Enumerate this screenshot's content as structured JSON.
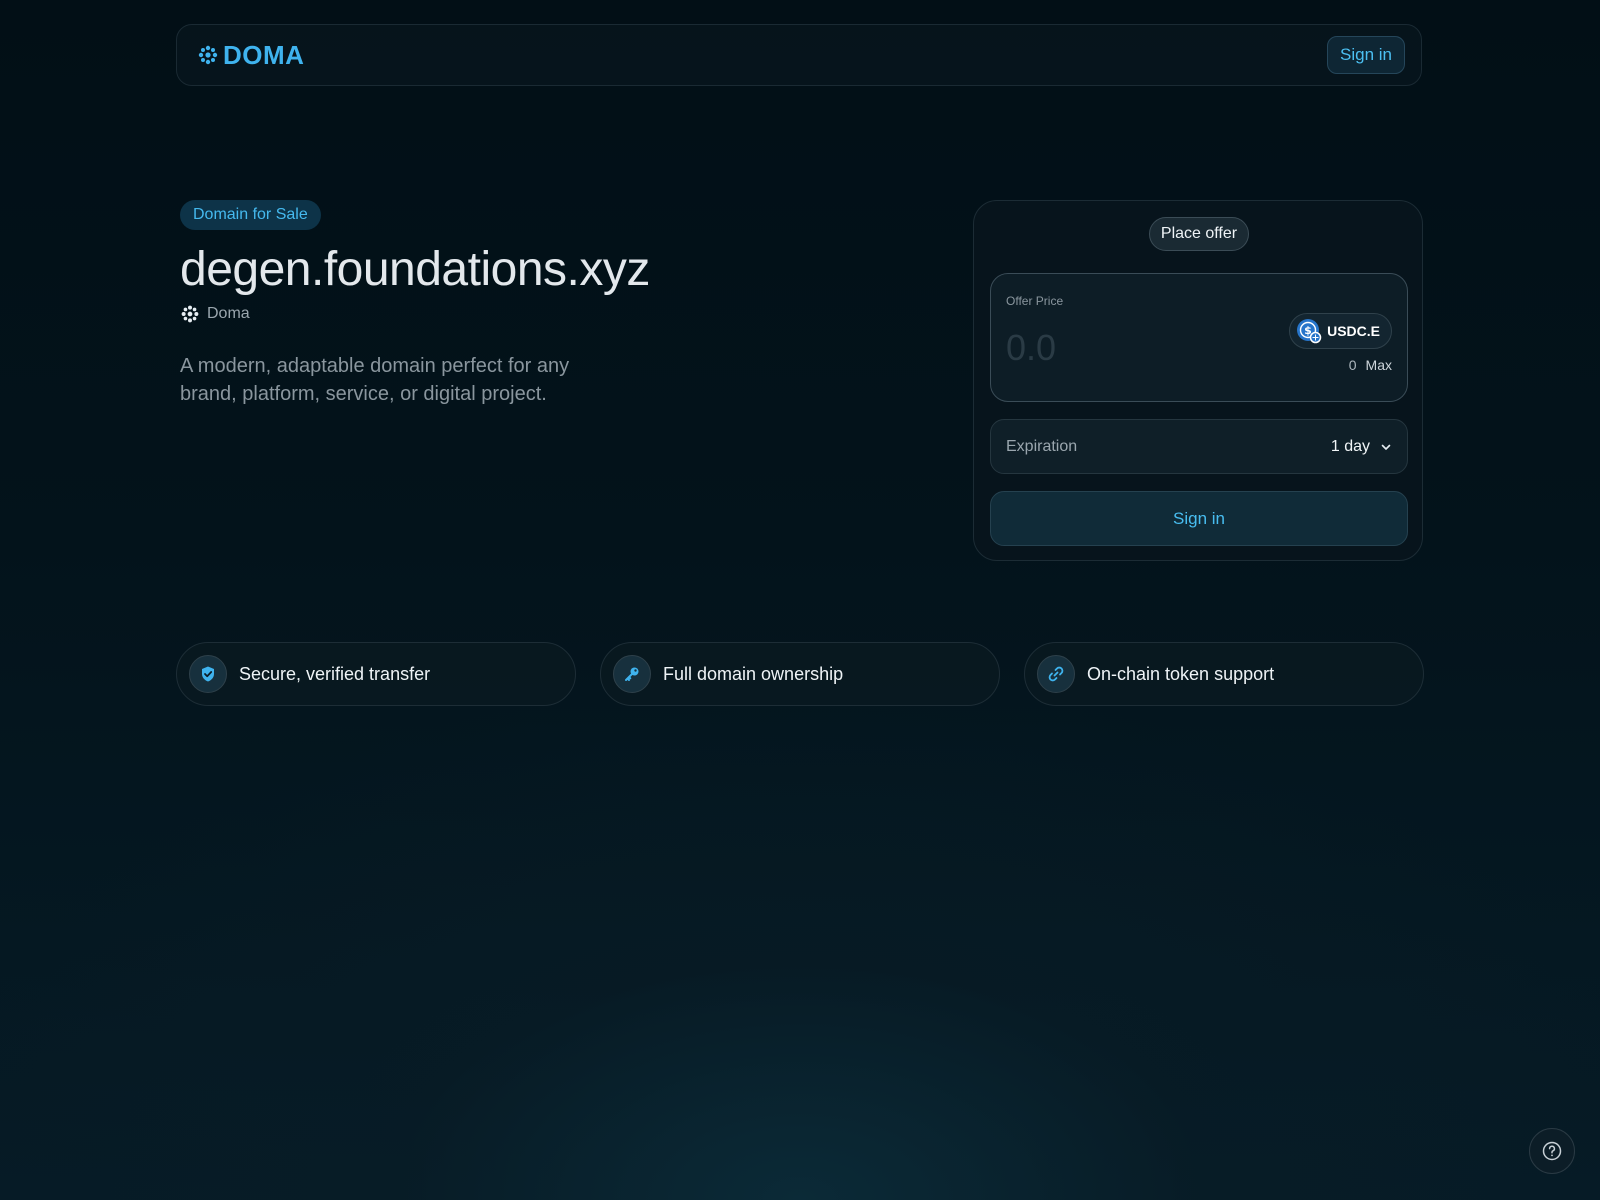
{
  "header": {
    "logo_text": "DOMA",
    "signin_label": "Sign in"
  },
  "hero": {
    "badge": "Domain for Sale",
    "domain_name": "degen.foundations.xyz",
    "owner_name": "Doma",
    "description": "A modern, adaptable domain perfect for any brand, platform, service, or digital project."
  },
  "offer_card": {
    "tab_label": "Place offer",
    "price_label": "Offer Price",
    "price_value": "",
    "price_placeholder": "0.0",
    "token_name": "USDC.E",
    "balance": "0",
    "max_label": "Max",
    "expiration_label": "Expiration",
    "expiration_value": "1 day",
    "signin_label": "Sign in"
  },
  "features": [
    {
      "label": "Secure, verified transfer",
      "icon": "shield-check-icon"
    },
    {
      "label": "Full domain ownership",
      "icon": "key-icon"
    },
    {
      "label": "On-chain token support",
      "icon": "link-icon"
    }
  ],
  "colors": {
    "accent": "#45b9ee",
    "background": "#03131b"
  },
  "help": {
    "icon": "help-circle-icon"
  }
}
